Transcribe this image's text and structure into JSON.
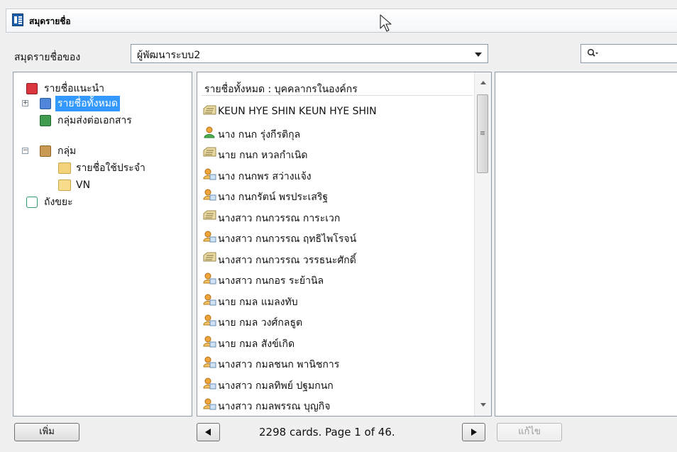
{
  "window": {
    "title": "สมุดรายชื่อ"
  },
  "owner": {
    "label": "สมุดรายชื่อของ",
    "selected": "ผู้พัฒนาระบบ2"
  },
  "search": {
    "placeholder": ""
  },
  "tree": {
    "items": [
      {
        "label": "รายชื่อแนะนำ",
        "icon": "recommended-contacts-icon",
        "color": "#d9363e"
      },
      {
        "label": "รายชื่อทั้งหมด",
        "icon": "all-contacts-icon",
        "color": "#4f86d9",
        "selected": true
      },
      {
        "label": "กลุ่มส่งต่อเอกสาร",
        "icon": "forward-group-icon",
        "color": "#3f9c4f"
      },
      {
        "label": "กลุ่ม",
        "icon": "group-icon",
        "color": "#c99a54"
      },
      {
        "label": "รายชื่อใช้ประจำ",
        "icon": "favorites-folder-icon",
        "color": "#f2c94c"
      },
      {
        "label": "VN",
        "icon": "folder-icon",
        "color": "#f2c94c"
      },
      {
        "label": "ถังขยะ",
        "icon": "trash-icon",
        "color": "#2f9a6a"
      }
    ]
  },
  "list": {
    "header": "รายชื่อทั้งหมด : บุคคลากรในองค์กร",
    "rows": [
      {
        "name": "KEUN HYE SHIN KEUN HYE SHIN",
        "icon": "contact-card-icon"
      },
      {
        "name": "นาง กนก รุ่งกีรติกุล",
        "icon": "person-icon"
      },
      {
        "name": "นาย กนก หวลกำเนิด",
        "icon": "contact-card-icon"
      },
      {
        "name": "นาง กนกพร สว่างแจ้ง",
        "icon": "person-card-icon"
      },
      {
        "name": "นาง กนกรัตน์ พรประเสริฐ",
        "icon": "person-card-icon"
      },
      {
        "name": "นางสาว กนกวรรณ การะเวก",
        "icon": "contact-card-icon"
      },
      {
        "name": "นางสาว กนกวรรณ ฤทธิไพโรจน์",
        "icon": "person-card-icon"
      },
      {
        "name": "นางสาว กนกวรรณ วรรธนะศักดิ์",
        "icon": "contact-card-icon"
      },
      {
        "name": "นางสาว กนกอร ระย้านิล",
        "icon": "person-card-icon"
      },
      {
        "name": "นาย กมล แมลงทับ",
        "icon": "person-card-icon"
      },
      {
        "name": "นาย กมล วงศ์กลธูต",
        "icon": "person-card-icon"
      },
      {
        "name": "นาย กมล สังข์เกิด",
        "icon": "person-card-icon"
      },
      {
        "name": "นางสาว กมลชนก พานิชการ",
        "icon": "person-card-icon"
      },
      {
        "name": "นางสาว กมลทิพย์ ปฐมกนก",
        "icon": "person-card-icon"
      },
      {
        "name": "นางสาว กมลพรรณ บุญกิจ",
        "icon": "person-card-icon"
      }
    ]
  },
  "footer": {
    "add_label": "เพิ่ม",
    "pager": "2298 cards. Page 1 of 46.",
    "edit_label": "แก้ไข"
  }
}
